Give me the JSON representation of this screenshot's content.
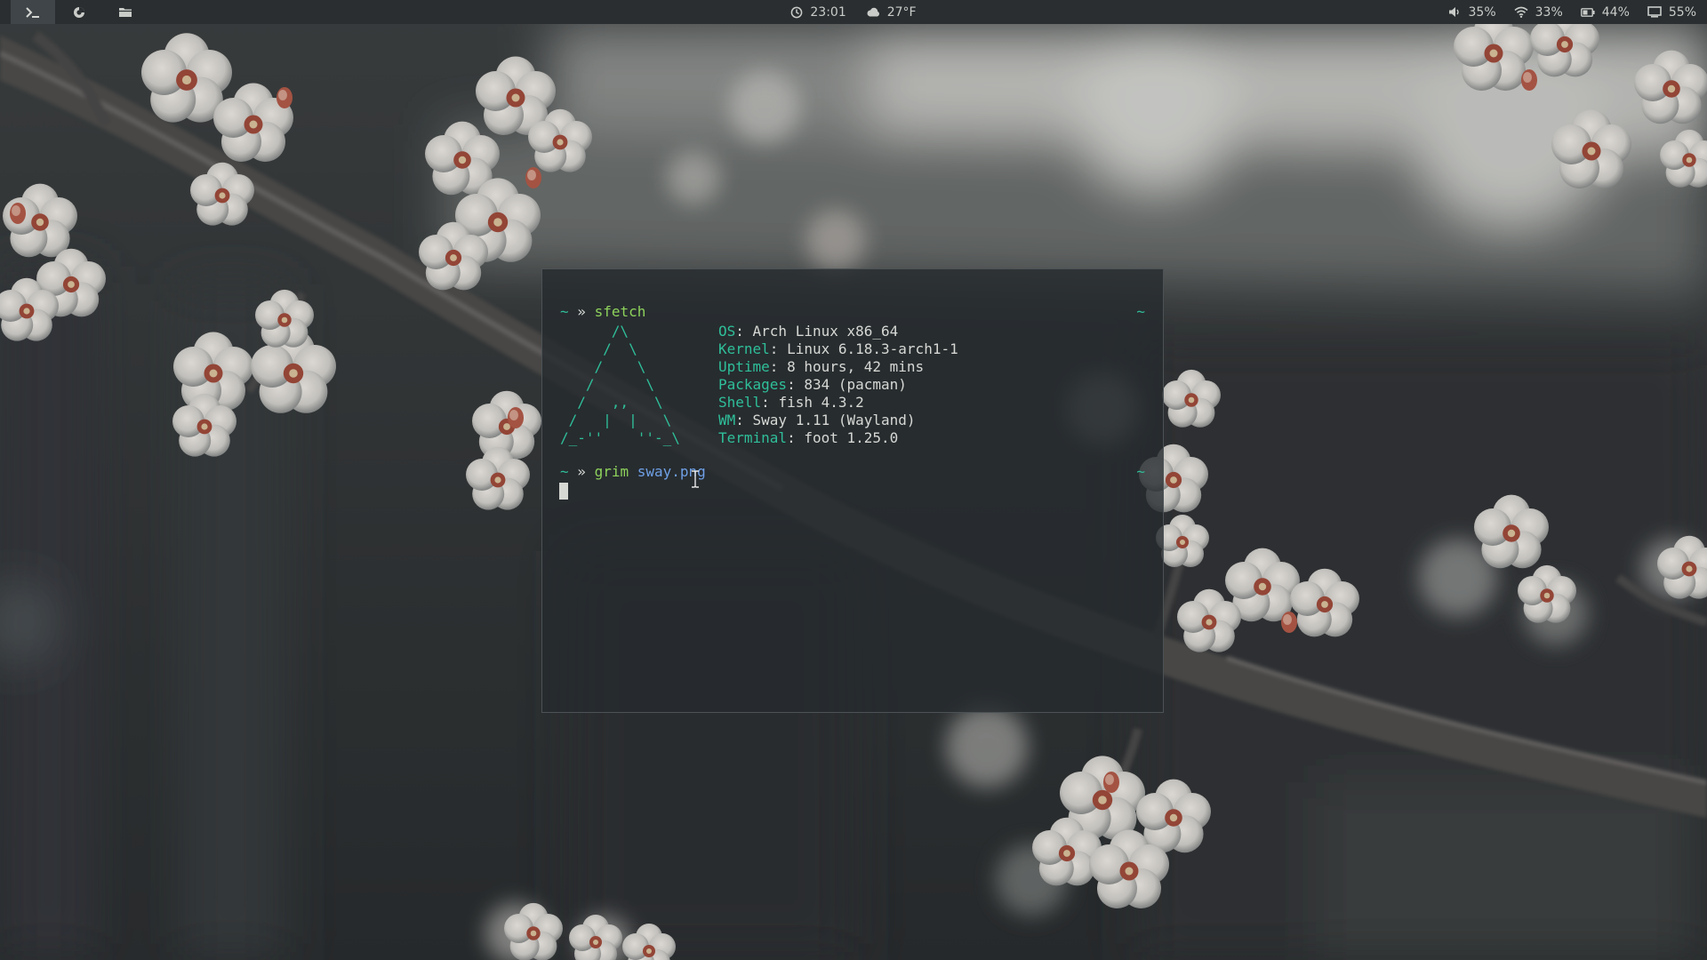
{
  "topbar": {
    "workspaces": [
      {
        "icon": "terminal-icon",
        "active": true
      },
      {
        "icon": "browser-icon",
        "active": false
      },
      {
        "icon": "folder-icon",
        "active": false
      }
    ],
    "clock": "23:01",
    "weather": "27°F",
    "volume": "35%",
    "wifi": "33%",
    "battery": "44%",
    "brightness": "55%"
  },
  "terminal": {
    "prompt_symbol": "~",
    "prompt_arrow": "»",
    "right_prompt": "~",
    "command1": {
      "cmd": "sfetch",
      "args": ""
    },
    "ascii_logo": "      /\\\n     /  \\\n    /    \\\n   /      \\\n  /   ,,   \\\n /   |  |   \\\n/_-''    ''-_\\",
    "info": [
      {
        "key": "OS",
        "value": "Arch Linux x86_64"
      },
      {
        "key": "Kernel",
        "value": "Linux 6.18.3-arch1-1"
      },
      {
        "key": "Uptime",
        "value": "8 hours, 42 mins"
      },
      {
        "key": "Packages",
        "value": "834 (pacman)"
      },
      {
        "key": "Shell",
        "value": "fish 4.3.2"
      },
      {
        "key": "WM",
        "value": "Sway 1.11 (Wayland)"
      },
      {
        "key": "Terminal",
        "value": "foot 1.25.0"
      }
    ],
    "command2": {
      "cmd": "grim",
      "args": "sway.png"
    }
  },
  "colors": {
    "bar_bg": "#2a2e31",
    "accent_teal": "#2fbf9a",
    "command_green": "#8ed25c",
    "arg_blue": "#6fa0e6",
    "text": "#d6d8d4"
  }
}
